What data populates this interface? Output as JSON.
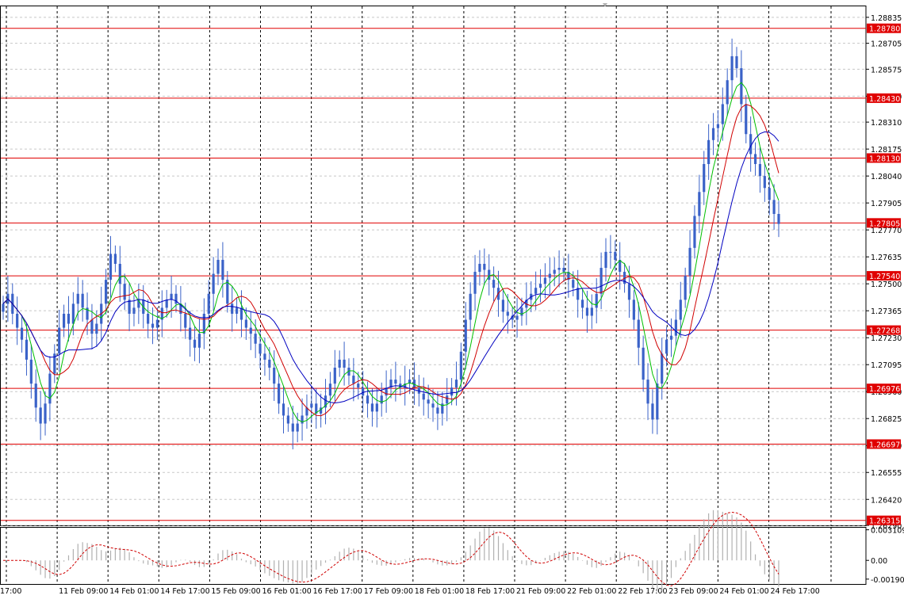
{
  "chart_data": [
    {
      "type": "candlestick",
      "title": "",
      "ylim": [
        1.2629,
        1.2889
      ],
      "grid": true,
      "y_ticks": [
        "1.28835",
        "1.28705",
        "1.28575",
        "1.28440",
        "1.28310",
        "1.28175",
        "1.28040",
        "1.27905",
        "1.27770",
        "1.27635",
        "1.27500",
        "1.27365",
        "1.27230",
        "1.27095",
        "1.26960",
        "1.26825",
        "1.26690",
        "1.26555",
        "1.26420",
        "1.26290"
      ],
      "x_ticks": [
        "17:00",
        "11 Feb 09:00",
        "14 Feb 01:00",
        "14 Feb 17:00",
        "15 Feb 09:00",
        "16 Feb 01:00",
        "16 Feb 17:00",
        "17 Feb 09:00",
        "18 Feb 01:00",
        "18 Feb 17:00",
        "21 Feb 09:00",
        "22 Feb 01:00",
        "22 Feb 17:00",
        "23 Feb 09:00",
        "24 Feb 01:00",
        "24 Feb 17:00"
      ],
      "horizontal_levels": [
        "1.28780",
        "1.28430",
        "1.28130",
        "1.27805",
        "1.27540",
        "1.27268",
        "1.26976",
        "1.26697",
        "1.26315"
      ],
      "level_color": "#e00000",
      "candle_color": "#3a62c8",
      "closes": [
        1.274,
        1.2745,
        1.2735,
        1.2728,
        1.2722,
        1.2712,
        1.27,
        1.2688,
        1.268,
        1.269,
        1.2705,
        1.2715,
        1.2728,
        1.2735,
        1.273,
        1.274,
        1.2745,
        1.2738,
        1.2732,
        1.2725,
        1.273,
        1.274,
        1.2752,
        1.2765,
        1.276,
        1.275,
        1.2742,
        1.2735,
        1.2738,
        1.2742,
        1.2735,
        1.273,
        1.2728,
        1.2732,
        1.2738,
        1.2742,
        1.2745,
        1.274,
        1.2735,
        1.2728,
        1.2722,
        1.2718,
        1.2725,
        1.2735,
        1.2745,
        1.2755,
        1.2762,
        1.2752,
        1.274,
        1.2735,
        1.2738,
        1.2732,
        1.2728,
        1.2725,
        1.272,
        1.2715,
        1.2712,
        1.2708,
        1.27,
        1.269,
        1.2684,
        1.268,
        1.2676,
        1.268,
        1.2684,
        1.2688,
        1.269,
        1.2685,
        1.2688,
        1.2694,
        1.27,
        1.2708,
        1.2712,
        1.2708,
        1.2704,
        1.27,
        1.2698,
        1.2694,
        1.269,
        1.2686,
        1.269,
        1.2694,
        1.2698,
        1.2702,
        1.27,
        1.2698,
        1.27,
        1.2702,
        1.2698,
        1.2695,
        1.2692,
        1.269,
        1.2688,
        1.2685,
        1.269,
        1.2694,
        1.2698,
        1.2702,
        1.2716,
        1.2732,
        1.2745,
        1.2756,
        1.276,
        1.2757,
        1.2752,
        1.2748,
        1.2742,
        1.2736,
        1.2734,
        1.2732,
        1.2734,
        1.2738,
        1.2742,
        1.2745,
        1.2748,
        1.275,
        1.2753,
        1.2755,
        1.2757,
        1.2758,
        1.2756,
        1.2752,
        1.2748,
        1.2742,
        1.2738,
        1.2734,
        1.2738,
        1.2745,
        1.2758,
        1.2766,
        1.2766,
        1.2762,
        1.2756,
        1.275,
        1.2742,
        1.2732,
        1.2718,
        1.2702,
        1.269,
        1.2682,
        1.27,
        1.2715,
        1.2722,
        1.2724,
        1.2732,
        1.2742,
        1.2754,
        1.2768,
        1.2784,
        1.2796,
        1.281,
        1.2822,
        1.2828,
        1.283,
        1.284,
        1.2852,
        1.2864,
        1.2858,
        1.284,
        1.2825,
        1.2815,
        1.281,
        1.2804,
        1.2798,
        1.2792,
        1.2785,
        1.278
      ],
      "indicator": {
        "name": "MACD",
        "y_ticks": [
          "0.003109",
          "0.00",
          "-0.001905"
        ],
        "ylim": [
          -0.0024,
          0.0034
        ],
        "line_color": "#d00000",
        "hist_color": "#b0b0b0"
      }
    }
  ]
}
